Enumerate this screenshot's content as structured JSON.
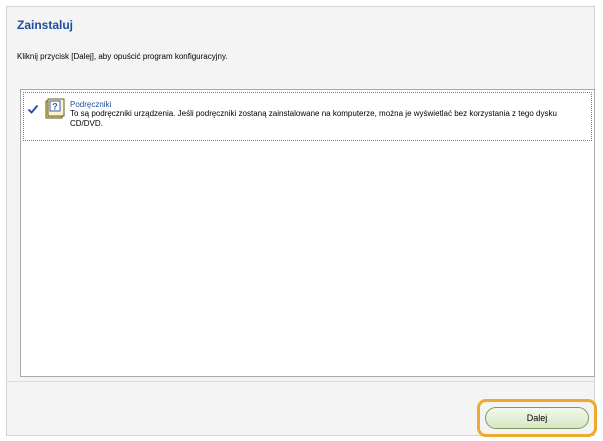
{
  "header": {
    "title": "Zainstaluj"
  },
  "instruction": "Kliknij przycisk [Dalej], aby opuścić program konfiguracyjny.",
  "components": [
    {
      "checked": true,
      "icon": "manual-book-icon",
      "title": "Podręczniki",
      "description": "To są podręczniki urządzenia. Jeśli podręczniki zostaną zainstalowane na komputerze, można je wyświetlać bez korzystania z tego dysku CD/DVD."
    }
  ],
  "footer": {
    "next_label": "Dalej"
  },
  "colors": {
    "title": "#1f4c9e",
    "highlight": "#f0a830",
    "button_border": "#7c9c58"
  }
}
